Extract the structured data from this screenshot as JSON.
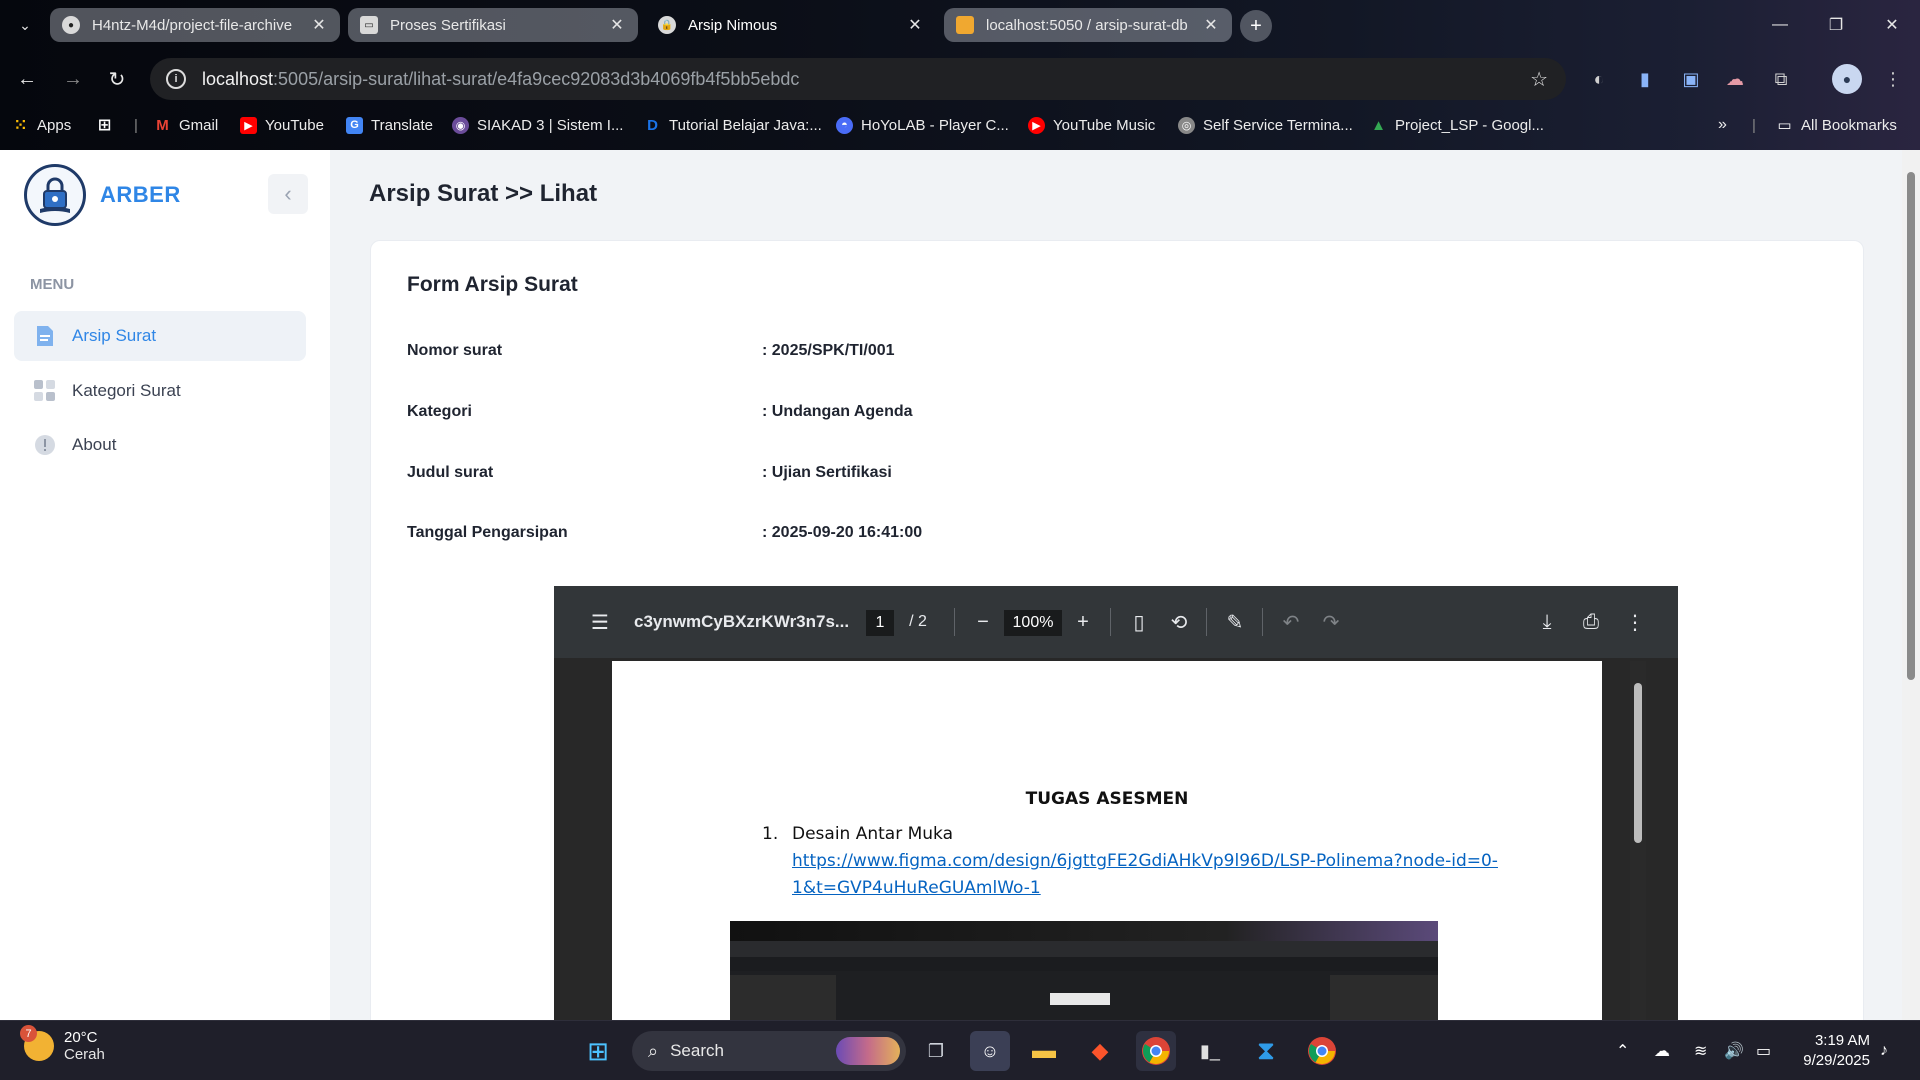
{
  "browser": {
    "tabs": [
      {
        "title": "H4ntz-M4d/project-file-archive",
        "icon": "github-icon"
      },
      {
        "title": "Proses Sertifikasi",
        "icon": "form-icon"
      },
      {
        "title": "Arsip Nimous",
        "icon": "lock-icon"
      },
      {
        "title": "localhost:5050 / arsip-surat-db",
        "icon": "pma-icon"
      }
    ],
    "url_host": "localhost",
    "url_path": ":5005/arsip-surat/lihat-surat/e4fa9cec92083d3b4069fb4f5bb5ebdc",
    "bookmarks": [
      {
        "label": "Apps",
        "color": "#4285f4"
      },
      {
        "label": "Gmail",
        "color": "#ea4335"
      },
      {
        "label": "YouTube",
        "color": "#ff0000"
      },
      {
        "label": "Translate",
        "color": "#4285f4"
      },
      {
        "label": "SIAKAD 3 | Sistem I...",
        "color": "#6b4c9a"
      },
      {
        "label": "Tutorial Belajar Java:...",
        "color": "#1a73e8"
      },
      {
        "label": "HoYoLAB - Player C...",
        "color": "#4a6cf7"
      },
      {
        "label": "YouTube Music",
        "color": "#ff0000"
      },
      {
        "label": "Self Service Termina...",
        "color": "#888888"
      },
      {
        "label": "Project_LSP - Googl...",
        "color": "#34a853"
      }
    ],
    "all_bookmarks": "All Bookmarks"
  },
  "sidebar": {
    "brand": "ARBER",
    "menu_title": "MENU",
    "items": [
      {
        "label": "Arsip Surat",
        "icon": "document-icon",
        "active": true
      },
      {
        "label": "Kategori Surat",
        "icon": "grid-icon",
        "active": false
      },
      {
        "label": "About",
        "icon": "info-icon",
        "active": false
      }
    ]
  },
  "main": {
    "page_title": "Arsip Surat >> Lihat",
    "card_title": "Form Arsip Surat",
    "fields": [
      {
        "label": "Nomor surat",
        "value": ": 2025/SPK/TI/001"
      },
      {
        "label": "Kategori",
        "value": ": Undangan Agenda"
      },
      {
        "label": "Judul surat",
        "value": ": Ujian Sertifikasi"
      },
      {
        "label": "Tanggal Pengarsipan",
        "value": ": 2025-09-20 16:41:00"
      }
    ]
  },
  "pdf": {
    "filename": "c3ynwmCyBXzrKWr3n7s...",
    "page_current": "1",
    "page_total": "/  2",
    "zoom": "100%",
    "doc_heading": "TUGAS ASESMEN",
    "list_number": "1.",
    "list_text": "Desain Antar Muka",
    "link_line1": "https://www.figma.com/design/6jgttgFE2GdiAHkVp9l96D/LSP-Polinema?node-id=0-",
    "link_line2": "1&t=GVP4uHuReGUAmlWo-1"
  },
  "taskbar": {
    "weather_temp": "20°C",
    "weather_desc": "Cerah",
    "weather_badge": "7",
    "search_label": "Search",
    "time": "3:19 AM",
    "date": "9/29/2025"
  }
}
